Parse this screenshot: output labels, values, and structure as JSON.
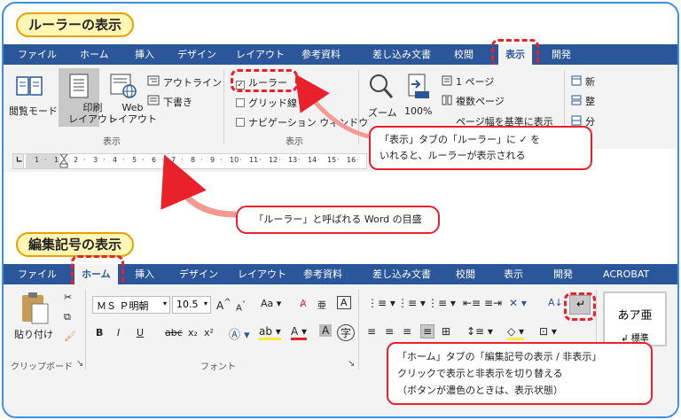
{
  "section1": {
    "title": "ルーラーの表示"
  },
  "ribbon1": {
    "tabs": [
      "ファイル",
      "ホーム",
      "挿入",
      "デザイン",
      "レイアウト",
      "参考資料",
      "差し込み文書",
      "校閲",
      "表示",
      "開発"
    ]
  },
  "view": {
    "read_mode": "閲覧モード",
    "print_layout": "印刷\nレイアウト",
    "web_layout": "Web\nレイアウト",
    "outline": "アウトライン",
    "draft": "下書き",
    "group1": "表示",
    "ruler": "ルーラー",
    "ruler_check": "✓",
    "gridlines": "グリッド線",
    "nav_pane": "ナビゲーション ウィンドウ",
    "group2": "表示",
    "zoom": "ズーム",
    "zoom100": "100%",
    "one_page": "1 ページ",
    "multi_page": "複数ページ",
    "page_width": "ページ幅を基準に表示",
    "new_window": "新",
    "arrange": "整",
    "split": "分"
  },
  "ruler_ticks": [
    "1",
    "·",
    "1",
    "·",
    "2",
    "·",
    "3",
    "·",
    "4",
    "·",
    "5",
    "·",
    "6",
    "·",
    "7",
    "·",
    "8",
    "·",
    "9",
    "·",
    "10",
    "·",
    "11",
    "·",
    "12",
    "·",
    "13",
    "·",
    "14",
    "·",
    "15",
    "·",
    "16",
    "·"
  ],
  "callout1": {
    "line1": "「表示」タブの「ルーラー」に ✓ を",
    "line2": "いれると、ルーラーが表示される"
  },
  "callout2": {
    "text": "「ルーラー」と呼ばれる Word の目盛"
  },
  "section2": {
    "title": "編集記号の表示"
  },
  "ribbon2": {
    "tabs": [
      "ファイル",
      "ホーム",
      "挿入",
      "デザイン",
      "レイアウト",
      "参考資料",
      "差し込み文書",
      "校閲",
      "表示",
      "開発",
      "ACROBAT"
    ]
  },
  "home": {
    "paste": "貼り付け",
    "clipboard": "クリップボード",
    "font_name": "ＭＳ Ｐ明朝",
    "font_size": "10.5",
    "font_group": "フォント",
    "bold": "B",
    "italic": "I",
    "underline": "U",
    "strike": "abc",
    "sub": "x₂",
    "sup": "x²",
    "style_sample": "あア亜",
    "style_name": "↲ 標準"
  },
  "callout3": {
    "line1": "「ホーム」タブの「編集記号の表示 / 非表示」",
    "line2": "クリックで表示と非表示を切り替える",
    "line3": "（ボタンが濃色のときは、表示状態）"
  }
}
